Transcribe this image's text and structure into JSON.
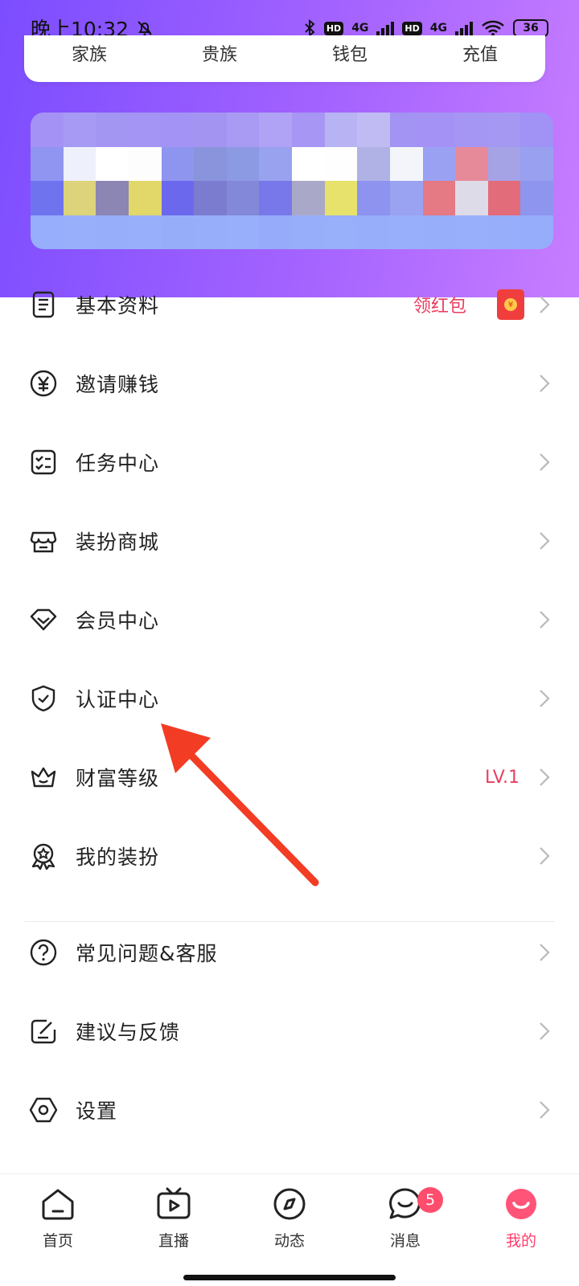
{
  "status_bar": {
    "time": "晚上10:32",
    "battery": "36",
    "network_1": "4G",
    "network_2": "4G",
    "hd_1": "HD",
    "hd_2": "HD"
  },
  "shortcuts": [
    {
      "label": "家族"
    },
    {
      "label": "贵族"
    },
    {
      "label": "钱包"
    },
    {
      "label": "充值"
    }
  ],
  "menu": {
    "items": [
      {
        "label": "基本资料",
        "icon": "document-icon",
        "extra": "领红包"
      },
      {
        "label": "邀请赚钱",
        "icon": "yuan-circle-icon",
        "extra": ""
      },
      {
        "label": "任务中心",
        "icon": "task-list-icon",
        "extra": ""
      },
      {
        "label": "装扮商城",
        "icon": "store-icon",
        "extra": ""
      },
      {
        "label": "会员中心",
        "icon": "diamond-icon",
        "extra": ""
      },
      {
        "label": "认证中心",
        "icon": "shield-check-icon",
        "extra": ""
      },
      {
        "label": "财富等级",
        "icon": "crown-icon",
        "extra": "LV.1"
      },
      {
        "label": "我的装扮",
        "icon": "medal-icon",
        "extra": ""
      },
      {
        "label": "常见问题&客服",
        "icon": "question-icon",
        "extra": ""
      },
      {
        "label": "建议与反馈",
        "icon": "edit-icon",
        "extra": ""
      },
      {
        "label": "设置",
        "icon": "hexagon-settings-icon",
        "extra": ""
      }
    ]
  },
  "bottom_nav": {
    "items": [
      {
        "label": "首页",
        "icon": "home-icon"
      },
      {
        "label": "直播",
        "icon": "tv-play-icon"
      },
      {
        "label": "动态",
        "icon": "compass-icon"
      },
      {
        "label": "消息",
        "icon": "chat-icon",
        "badge": "5"
      },
      {
        "label": "我的",
        "icon": "profile-icon"
      }
    ],
    "active_index": 4
  },
  "colors": {
    "accent_pink": "#ff3d6b",
    "red_extra": "#e83e5f",
    "header_gradient_start": "#7c4dff",
    "header_gradient_end": "#c77dff",
    "annotation_arrow": "#f23c24"
  }
}
